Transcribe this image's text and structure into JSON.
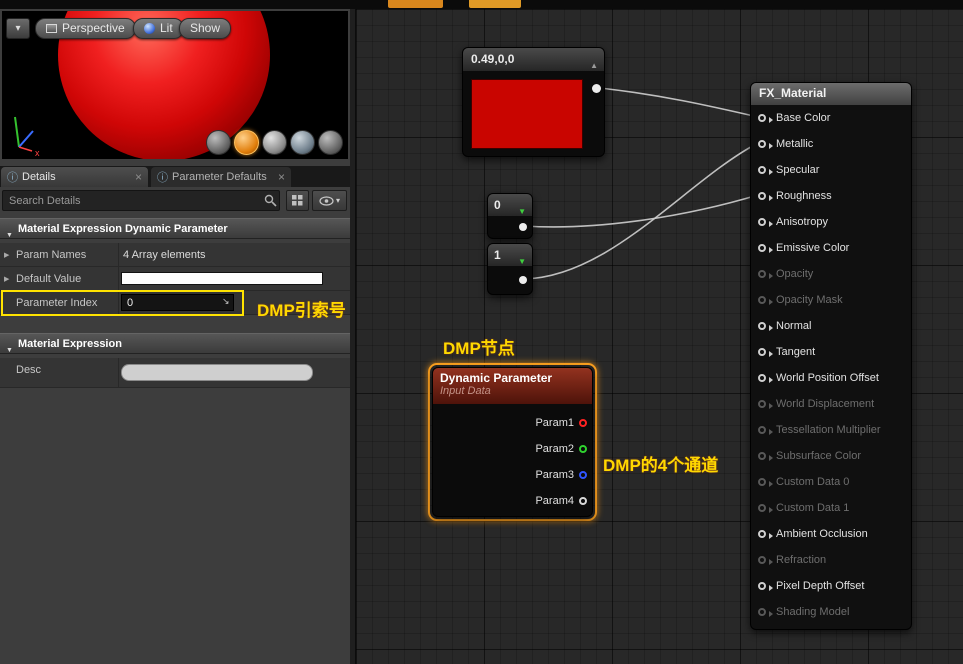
{
  "viewport": {
    "buttons": [
      {
        "label": "Perspective"
      },
      {
        "label": "Lit"
      },
      {
        "label": "Show"
      }
    ],
    "axis_label": "x"
  },
  "details": {
    "tabs": [
      {
        "label": "Details"
      },
      {
        "label": "Parameter Defaults"
      }
    ],
    "tab_close": "×",
    "search_placeholder": "Search Details",
    "sections": [
      {
        "title": "Material Expression Dynamic Parameter"
      },
      {
        "title": "Material Expression"
      }
    ],
    "rows": {
      "param_names": {
        "label": "Param Names",
        "value": "4 Array elements"
      },
      "default_value": {
        "label": "Default Value"
      },
      "parameter_index": {
        "label": "Parameter Index",
        "value": "0"
      },
      "desc": {
        "label": "Desc"
      }
    }
  },
  "annotations": {
    "parameter_index": "DMP引索号",
    "dp_node": "DMP节点",
    "dp_channels": "DMP的4个通道"
  },
  "graph": {
    "constant3": {
      "title": "0.49,0,0",
      "swatch_color": "#c90500"
    },
    "constant_zero": {
      "value": "0"
    },
    "constant_one": {
      "value": "1"
    },
    "dynamic_parameter": {
      "title": "Dynamic Parameter",
      "subtitle": "Input Data",
      "outputs": [
        {
          "label": "Param1",
          "color": "#ff2222"
        },
        {
          "label": "Param2",
          "color": "#2fd32f"
        },
        {
          "label": "Param3",
          "color": "#2f55ff"
        },
        {
          "label": "Param4",
          "color": "#d8d8d8"
        }
      ]
    },
    "material": {
      "title": "FX_Material",
      "pins": [
        {
          "label": "Base Color",
          "enabled": true
        },
        {
          "label": "Metallic",
          "enabled": true
        },
        {
          "label": "Specular",
          "enabled": true
        },
        {
          "label": "Roughness",
          "enabled": true
        },
        {
          "label": "Anisotropy",
          "enabled": true
        },
        {
          "label": "Emissive Color",
          "enabled": true
        },
        {
          "label": "Opacity",
          "enabled": false
        },
        {
          "label": "Opacity Mask",
          "enabled": false
        },
        {
          "label": "Normal",
          "enabled": true
        },
        {
          "label": "Tangent",
          "enabled": true
        },
        {
          "label": "World Position Offset",
          "enabled": true
        },
        {
          "label": "World Displacement",
          "enabled": false
        },
        {
          "label": "Tessellation Multiplier",
          "enabled": false
        },
        {
          "label": "Subsurface Color",
          "enabled": false
        },
        {
          "label": "Custom Data 0",
          "enabled": false
        },
        {
          "label": "Custom Data 1",
          "enabled": false
        },
        {
          "label": "Ambient Occlusion",
          "enabled": true
        },
        {
          "label": "Refraction",
          "enabled": false
        },
        {
          "label": "Pixel Depth Offset",
          "enabled": true
        },
        {
          "label": "Shading Model",
          "enabled": false
        }
      ]
    }
  },
  "colors": {
    "highlight_box": "#ffe300",
    "selection_outline": "#ffa21f",
    "annotation_text": "#ffd800",
    "wire": "#cfcfcf",
    "swatch_red": "#c90500"
  }
}
